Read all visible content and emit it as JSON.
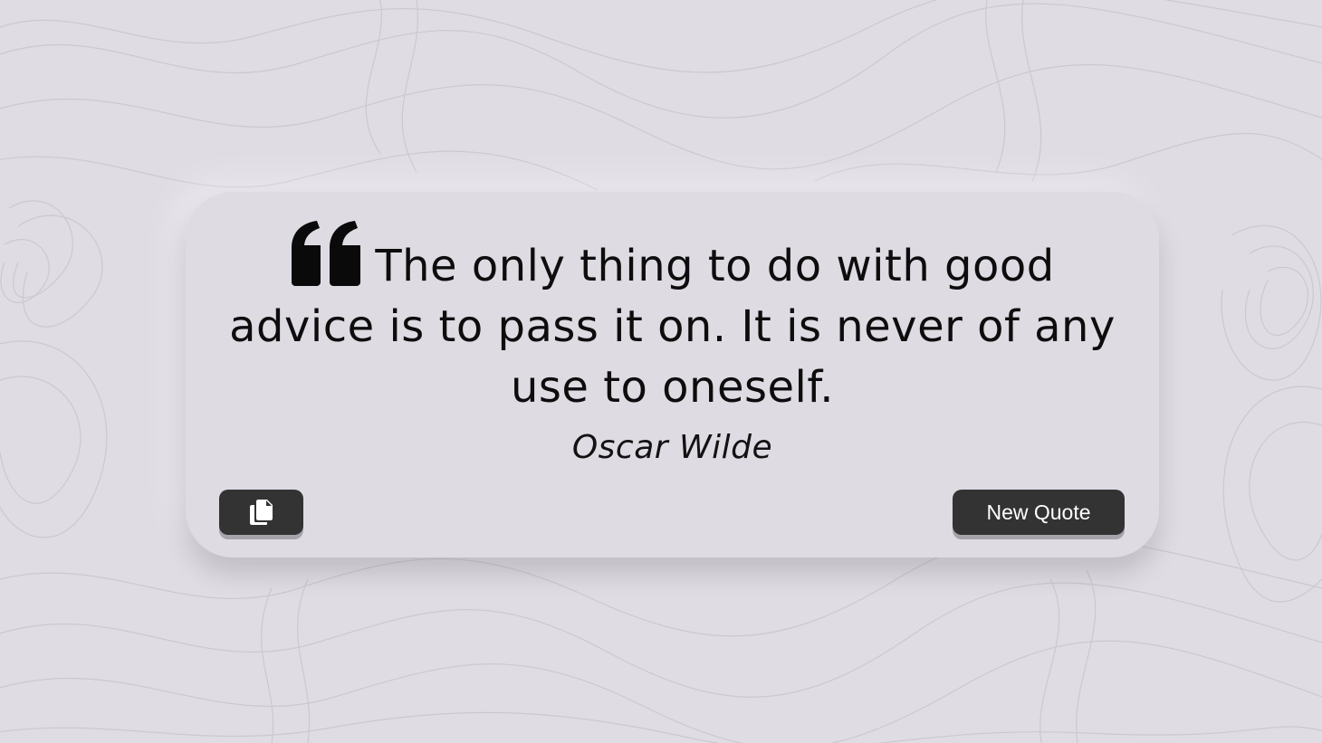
{
  "quote": {
    "text": "The only thing to do with good advice is to pass it on. It is never of any use to oneself.",
    "author": "Oscar Wilde",
    "quote_icon": "quote-left-icon"
  },
  "actions": {
    "copy_icon": "copy-icon",
    "new_quote_label": "New Quote"
  },
  "colors": {
    "background": "#dfdce4",
    "card": "#dedbe3",
    "button": "#333333",
    "button_text": "#ffffff",
    "text": "#0d0d0d"
  }
}
